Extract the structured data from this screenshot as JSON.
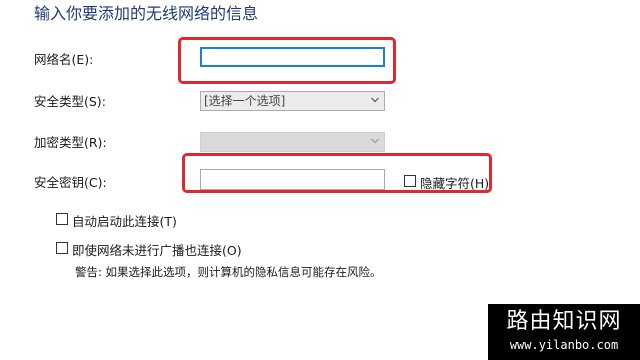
{
  "heading": "输入你要添加的无线网络的信息",
  "network_name": {
    "label": "网络名(E):",
    "value": ""
  },
  "security_type": {
    "label": "安全类型(S):",
    "selected": "[选择一个选项]"
  },
  "encryption_type": {
    "label": "加密类型(R):",
    "selected": ""
  },
  "security_key": {
    "label": "安全密钥(C):",
    "value": "",
    "hide_chars_label": "隐藏字符(H)"
  },
  "auto_connect": {
    "label": "自动启动此连接(T)"
  },
  "connect_hidden": {
    "label": "即使网络未进行广播也连接(O)",
    "warning": "警告: 如果选择此选项，则计算机的隐私信息可能存在风险。"
  },
  "watermark": {
    "title": "路由知识网",
    "url": "www.yilanbo.com"
  },
  "colors": {
    "heading": "#1f3a7a",
    "highlight": "#e0282f",
    "focus_border": "#1d7fd1"
  }
}
